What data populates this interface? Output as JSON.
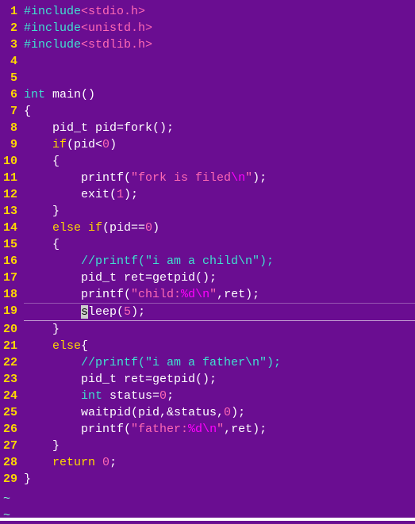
{
  "lines": [
    {
      "num": "1",
      "tokens": [
        {
          "t": "#include",
          "c": "cyan"
        },
        {
          "t": "<stdio.h>",
          "c": "pink"
        }
      ]
    },
    {
      "num": "2",
      "tokens": [
        {
          "t": "#include",
          "c": "cyan"
        },
        {
          "t": "<unistd.h>",
          "c": "pink"
        }
      ]
    },
    {
      "num": "3",
      "tokens": [
        {
          "t": "#include",
          "c": "cyan"
        },
        {
          "t": "<stdlib.h>",
          "c": "pink"
        }
      ]
    },
    {
      "num": "4",
      "tokens": []
    },
    {
      "num": "5",
      "tokens": []
    },
    {
      "num": "6",
      "tokens": [
        {
          "t": "int",
          "c": "cyan"
        },
        {
          "t": " main()",
          "c": "white"
        }
      ]
    },
    {
      "num": "7",
      "tokens": [
        {
          "t": "{",
          "c": "white"
        }
      ]
    },
    {
      "num": "8",
      "tokens": [
        {
          "t": "    pid_t pid=fork();",
          "c": "white"
        }
      ]
    },
    {
      "num": "9",
      "tokens": [
        {
          "t": "    ",
          "c": "white"
        },
        {
          "t": "if",
          "c": "yellow"
        },
        {
          "t": "(pid<",
          "c": "white"
        },
        {
          "t": "0",
          "c": "pink"
        },
        {
          "t": ")",
          "c": "white"
        }
      ]
    },
    {
      "num": "10",
      "tokens": [
        {
          "t": "    {",
          "c": "white"
        }
      ]
    },
    {
      "num": "11",
      "tokens": [
        {
          "t": "        printf(",
          "c": "white"
        },
        {
          "t": "\"fork is filed",
          "c": "pink"
        },
        {
          "t": "\\n",
          "c": "magenta"
        },
        {
          "t": "\"",
          "c": "pink"
        },
        {
          "t": ");",
          "c": "white"
        }
      ]
    },
    {
      "num": "12",
      "tokens": [
        {
          "t": "        exit(",
          "c": "white"
        },
        {
          "t": "1",
          "c": "pink"
        },
        {
          "t": ");",
          "c": "white"
        }
      ]
    },
    {
      "num": "13",
      "tokens": [
        {
          "t": "    }",
          "c": "white"
        }
      ]
    },
    {
      "num": "14",
      "tokens": [
        {
          "t": "    ",
          "c": "white"
        },
        {
          "t": "else if",
          "c": "yellow"
        },
        {
          "t": "(pid==",
          "c": "white"
        },
        {
          "t": "0",
          "c": "pink"
        },
        {
          "t": ")",
          "c": "white"
        }
      ]
    },
    {
      "num": "15",
      "tokens": [
        {
          "t": "    {",
          "c": "white"
        }
      ]
    },
    {
      "num": "16",
      "tokens": [
        {
          "t": "        ",
          "c": "white"
        },
        {
          "t": "//printf(\"i am a child\\n\");",
          "c": "cyan"
        }
      ]
    },
    {
      "num": "17",
      "tokens": [
        {
          "t": "        pid_t ret=getpid();",
          "c": "white"
        }
      ]
    },
    {
      "num": "18",
      "tokens": [
        {
          "t": "        printf(",
          "c": "white"
        },
        {
          "t": "\"child:",
          "c": "pink"
        },
        {
          "t": "%d",
          "c": "magenta"
        },
        {
          "t": "\\n",
          "c": "magenta"
        },
        {
          "t": "\"",
          "c": "pink"
        },
        {
          "t": ",ret);",
          "c": "white"
        }
      ]
    },
    {
      "num": "19",
      "cursor": true,
      "tokens": [
        {
          "t": "        ",
          "c": "white"
        },
        {
          "t": "s",
          "cursor": true
        },
        {
          "t": "leep(",
          "c": "white"
        },
        {
          "t": "5",
          "c": "pink"
        },
        {
          "t": ");",
          "c": "white"
        }
      ]
    },
    {
      "num": "20",
      "tokens": [
        {
          "t": "    }",
          "c": "white"
        }
      ]
    },
    {
      "num": "21",
      "tokens": [
        {
          "t": "    ",
          "c": "white"
        },
        {
          "t": "else",
          "c": "yellow"
        },
        {
          "t": "{",
          "c": "white"
        }
      ]
    },
    {
      "num": "22",
      "tokens": [
        {
          "t": "        ",
          "c": "white"
        },
        {
          "t": "//printf(\"i am a father\\n\");",
          "c": "cyan"
        }
      ]
    },
    {
      "num": "23",
      "tokens": [
        {
          "t": "        pid_t ret=getpid();",
          "c": "white"
        }
      ]
    },
    {
      "num": "24",
      "tokens": [
        {
          "t": "        ",
          "c": "white"
        },
        {
          "t": "int",
          "c": "cyan"
        },
        {
          "t": " status=",
          "c": "white"
        },
        {
          "t": "0",
          "c": "pink"
        },
        {
          "t": ";",
          "c": "white"
        }
      ]
    },
    {
      "num": "25",
      "tokens": [
        {
          "t": "        waitpid(pid,&status,",
          "c": "white"
        },
        {
          "t": "0",
          "c": "pink"
        },
        {
          "t": ");",
          "c": "white"
        }
      ]
    },
    {
      "num": "26",
      "tokens": [
        {
          "t": "        printf(",
          "c": "white"
        },
        {
          "t": "\"father:",
          "c": "pink"
        },
        {
          "t": "%d",
          "c": "magenta"
        },
        {
          "t": "\\n",
          "c": "magenta"
        },
        {
          "t": "\"",
          "c": "pink"
        },
        {
          "t": ",ret);",
          "c": "white"
        }
      ]
    },
    {
      "num": "27",
      "tokens": [
        {
          "t": "    }",
          "c": "white"
        }
      ]
    },
    {
      "num": "28",
      "tokens": [
        {
          "t": "    ",
          "c": "white"
        },
        {
          "t": "return",
          "c": "yellow"
        },
        {
          "t": " ",
          "c": "white"
        },
        {
          "t": "0",
          "c": "pink"
        },
        {
          "t": ";",
          "c": "white"
        }
      ]
    },
    {
      "num": "29",
      "tokens": [
        {
          "t": "}",
          "c": "white"
        }
      ]
    }
  ],
  "tilde": "~",
  "status": {
    "left": "",
    "right": ""
  }
}
